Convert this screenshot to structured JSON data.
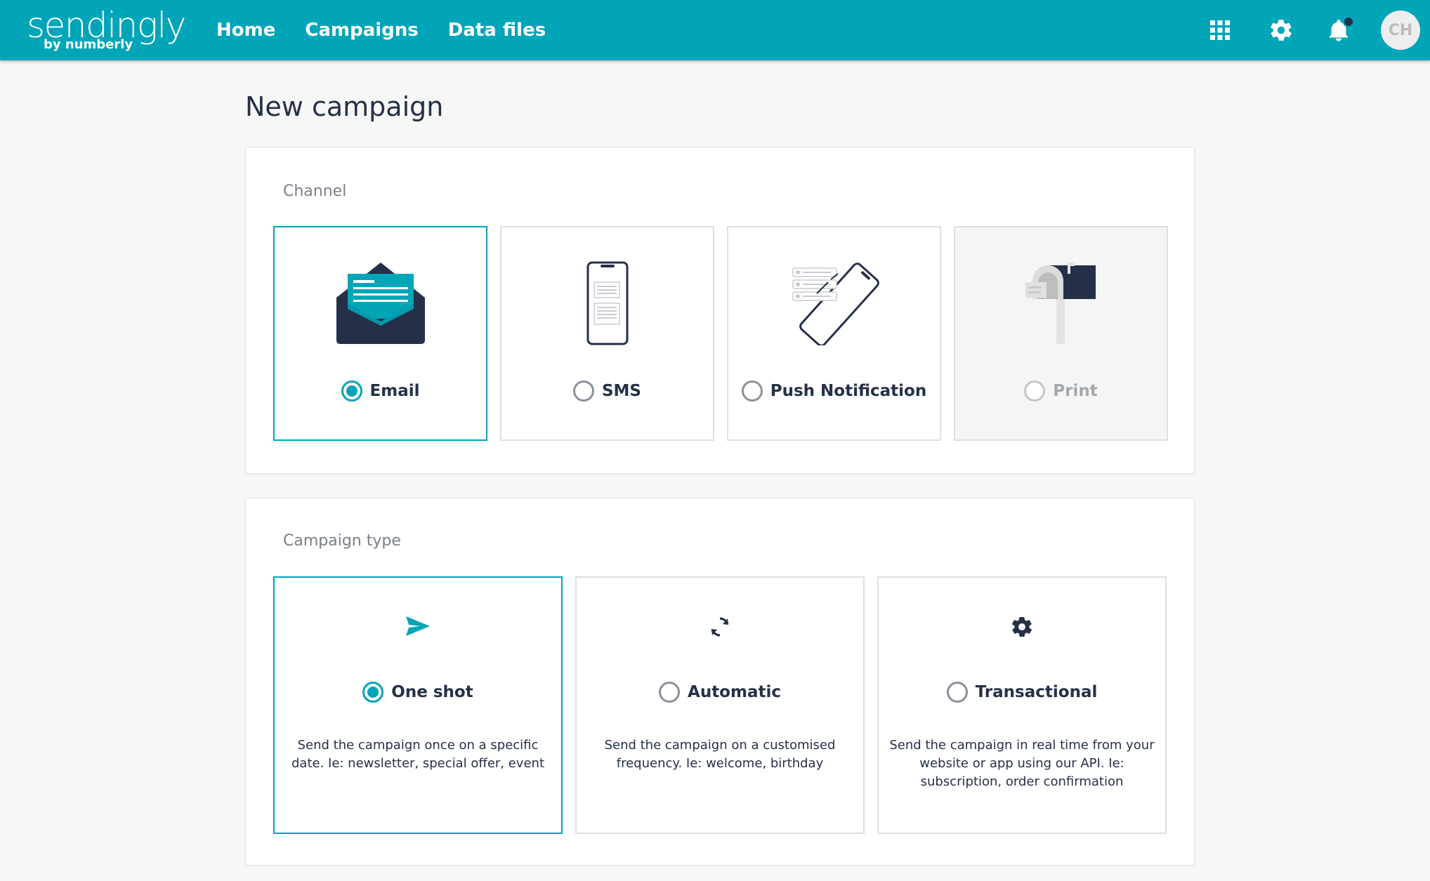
{
  "app": {
    "logo": {
      "name": "sendingly",
      "tagline": "by numberly"
    },
    "nav": [
      {
        "label": "Home"
      },
      {
        "label": "Campaigns"
      },
      {
        "label": "Data files"
      }
    ],
    "icons": [
      "apps-grid-icon",
      "gear-icon",
      "bell-icon"
    ],
    "avatar_initials": "CH",
    "colors": {
      "brand": "#00a5b8",
      "navy": "#253048"
    }
  },
  "page": {
    "title": "New campaign",
    "channel": {
      "label": "Channel",
      "options": [
        {
          "label": "Email",
          "icon": "email-envelope-icon",
          "selected": true,
          "disabled": false
        },
        {
          "label": "SMS",
          "icon": "smartphone-icon",
          "selected": false,
          "disabled": false
        },
        {
          "label": "Push Notification",
          "icon": "push-notification-icon",
          "selected": false,
          "disabled": false
        },
        {
          "label": "Print",
          "icon": "mailbox-icon",
          "selected": false,
          "disabled": true
        }
      ]
    },
    "campaign_type": {
      "label": "Campaign type",
      "options": [
        {
          "label": "One shot",
          "icon": "paper-plane-icon",
          "selected": true,
          "description": "Send the campaign once on a specific date. Ie: newsletter, special offer, event"
        },
        {
          "label": "Automatic",
          "icon": "refresh-icon",
          "selected": false,
          "description": "Send the campaign on a customised frequency. Ie: welcome, birthday"
        },
        {
          "label": "Transactional",
          "icon": "gear-icon",
          "selected": false,
          "description": "Send the campaign in real time from your website or app using our API. Ie: subscription, order confirmation"
        }
      ]
    }
  }
}
